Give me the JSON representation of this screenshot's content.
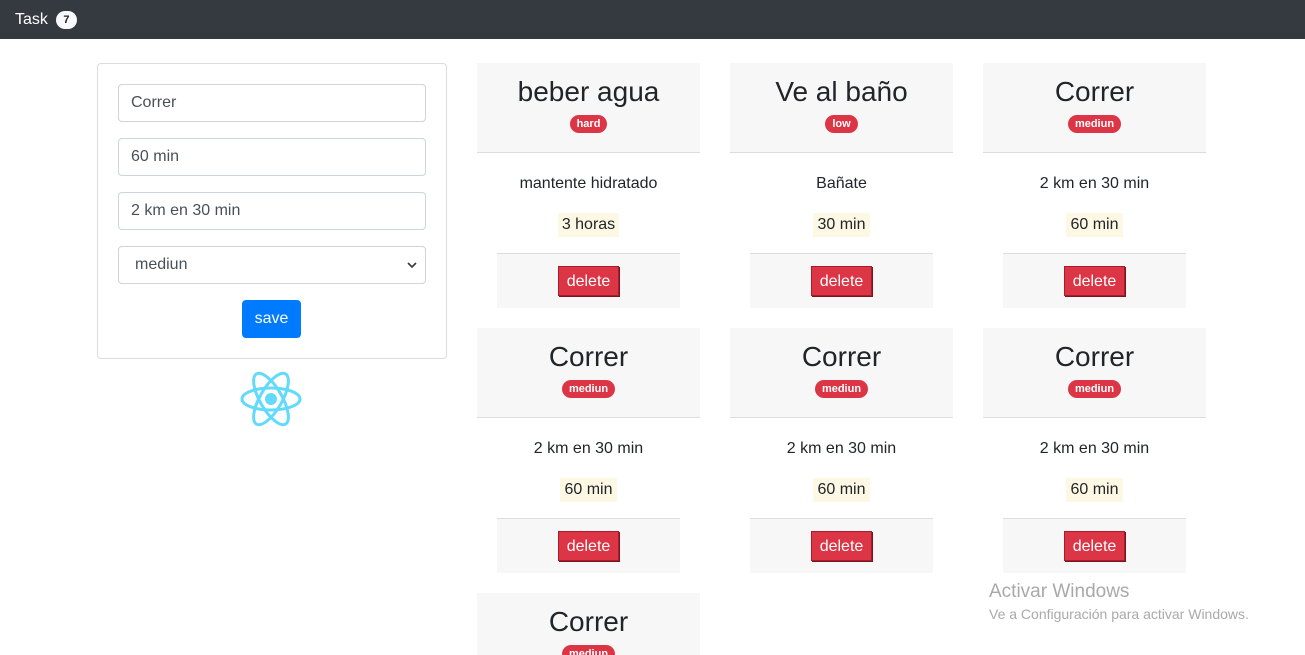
{
  "navbar": {
    "brand": "Task",
    "count": "7"
  },
  "form": {
    "title_value": "Correr",
    "duration_value": "60 min",
    "description_value": "2 km en 30 min",
    "priority_selected": "mediun",
    "save_label": "save"
  },
  "tasks": [
    {
      "title": "beber agua",
      "priority": "hard",
      "description": "mantente hidratado",
      "duration": "3 horas",
      "delete_label": "delete"
    },
    {
      "title": "Ve al baño",
      "priority": "low",
      "description": "Bañate",
      "duration": "30 min",
      "delete_label": "delete"
    },
    {
      "title": "Correr",
      "priority": "mediun",
      "description": "2 km en 30 min",
      "duration": "60 min",
      "delete_label": "delete"
    },
    {
      "title": "Correr",
      "priority": "mediun",
      "description": "2 km en 30 min",
      "duration": "60 min",
      "delete_label": "delete"
    },
    {
      "title": "Correr",
      "priority": "mediun",
      "description": "2 km en 30 min",
      "duration": "60 min",
      "delete_label": "delete"
    },
    {
      "title": "Correr",
      "priority": "mediun",
      "description": "2 km en 30 min",
      "duration": "60 min",
      "delete_label": "delete"
    },
    {
      "title": "Correr",
      "priority": "mediun"
    }
  ],
  "watermark": {
    "line1": "Activar Windows",
    "line2": "Ve a Configuración para activar Windows."
  },
  "colors": {
    "navbar": "#343a40",
    "primary": "#007bff",
    "danger": "#dc3545",
    "react": "#61dafb"
  },
  "icons": {
    "logo": "react-atom-icon",
    "select_arrow": "chevron-down-icon"
  }
}
